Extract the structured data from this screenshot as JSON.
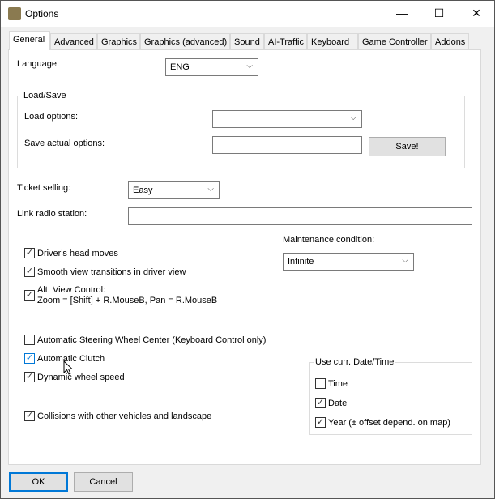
{
  "window": {
    "title": "Options",
    "minimize": "—",
    "maximize": "☐",
    "close": "✕"
  },
  "tabs": [
    "General",
    "Advanced",
    "Graphics",
    "Graphics (advanced)",
    "Sound",
    "AI-Traffic",
    "Keyboard",
    "Game Controller",
    "Addons"
  ],
  "language": {
    "label": "Language:",
    "value": "ENG"
  },
  "load_save": {
    "title": "Load/Save",
    "load_label": "Load options:",
    "load_value": "",
    "save_label": "Save actual options:",
    "save_value": "",
    "save_button": "Save!"
  },
  "ticket": {
    "label": "Ticket selling:",
    "value": "Easy"
  },
  "radio": {
    "label": "Link radio station:",
    "value": ""
  },
  "maintenance": {
    "label": "Maintenance condition:",
    "value": "Infinite"
  },
  "checkboxes": [
    {
      "label": "Driver's head moves",
      "checked": true
    },
    {
      "label": "Smooth view transitions in driver view",
      "checked": true
    },
    {
      "label": "Alt. View Control:",
      "label2": "Zoom = [Shift] + R.MouseB, Pan = R.MouseB",
      "checked": true
    },
    {
      "label": "Automatic Steering Wheel Center (Keyboard Control only)",
      "checked": false
    },
    {
      "label": "Automatic Clutch",
      "checked": true
    },
    {
      "label": "Dynamic wheel speed",
      "checked": true
    },
    {
      "label": "Collisions with other vehicles and landscape",
      "checked": true
    }
  ],
  "datetime": {
    "title": "Use curr. Date/Time",
    "items": [
      {
        "label": "Time",
        "checked": false
      },
      {
        "label": "Date",
        "checked": true
      },
      {
        "label": "Year (± offset depend. on map)",
        "checked": true
      }
    ]
  },
  "buttons": {
    "ok": "OK",
    "cancel": "Cancel"
  }
}
